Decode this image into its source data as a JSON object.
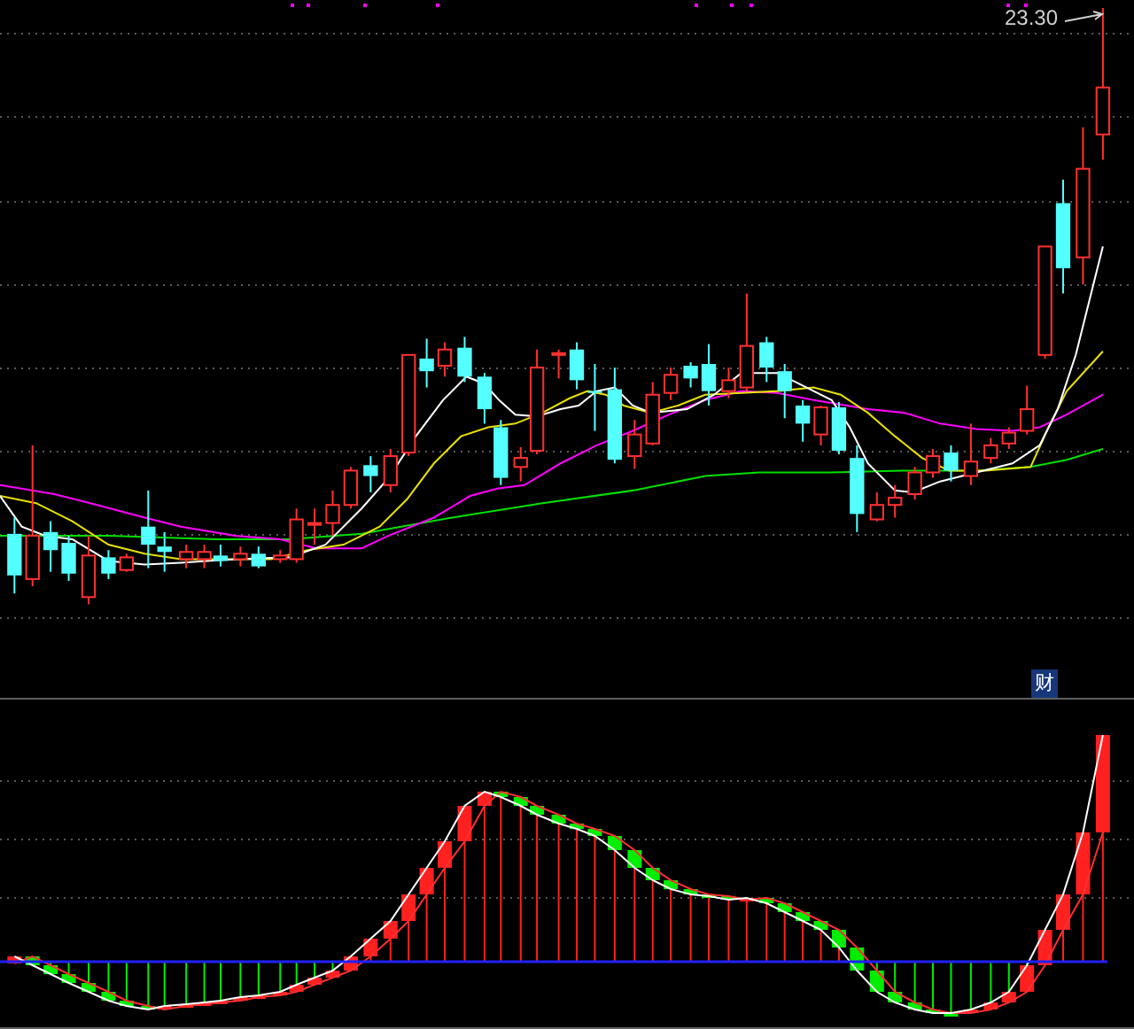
{
  "price_chart": {
    "price_label": "23.30"
  },
  "corner_badge": "财"
}
